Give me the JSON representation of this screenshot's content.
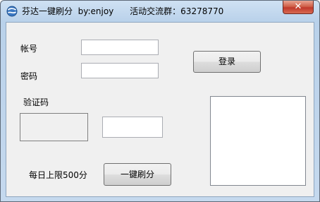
{
  "window": {
    "title": "芬达一键刷分  by:enjoy      活动交流群：63278770",
    "close_label": "✕",
    "app_icon": "globe-swirl-icon"
  },
  "form": {
    "account_label": "帐号",
    "account_value": "",
    "password_label": "密码",
    "password_value": "",
    "login_button": "登录",
    "captcha_label": "验证码",
    "captcha_value": "",
    "limit_text": "每日上限500分",
    "one_click_button": "一键刷分"
  },
  "log": {
    "content": ""
  },
  "colors": {
    "client_bg": "#f0f0f0",
    "close_button": "#c0392b",
    "titlebar": "#b9d1ea"
  }
}
